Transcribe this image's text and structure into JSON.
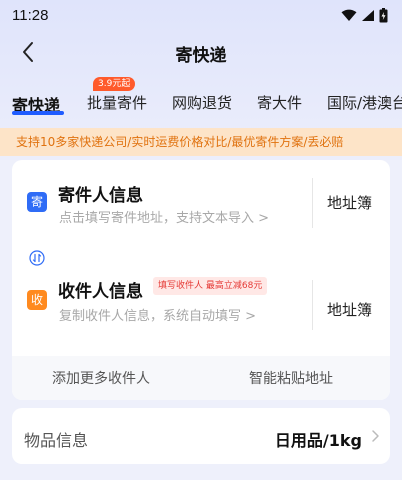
{
  "status_bar": {
    "time": "11:28"
  },
  "nav": {
    "title": "寄快递"
  },
  "tabs": [
    {
      "label": "寄快递"
    },
    {
      "label": "批量寄件",
      "badge": "3.9元起"
    },
    {
      "label": "网购退货"
    },
    {
      "label": "寄大件"
    },
    {
      "label": "国际/港澳台"
    }
  ],
  "promo_text": "支持10多家快递公司/实时运费价格对比/最优寄件方案/丢必赔",
  "sender": {
    "badge": "寄",
    "title": "寄件人信息",
    "hint": "点击填写寄件地址，支持文本导入 >",
    "address_book": "地址簿"
  },
  "receiver": {
    "badge": "收",
    "title": "收件人信息",
    "tag": "填写收件人 最高立减68元",
    "hint": "复制收件人信息，系统自动填写 >",
    "address_book": "地址簿"
  },
  "footer": {
    "add_receiver": "添加更多收件人",
    "smart_paste": "智能粘贴地址"
  },
  "goods": {
    "label": "物品信息",
    "value": "日用品/1kg"
  },
  "colors": {
    "accent": "#1f5cff",
    "promo_bg": "#fde4c8",
    "promo_text": "#e0720f",
    "tag_red": "#e53935"
  }
}
